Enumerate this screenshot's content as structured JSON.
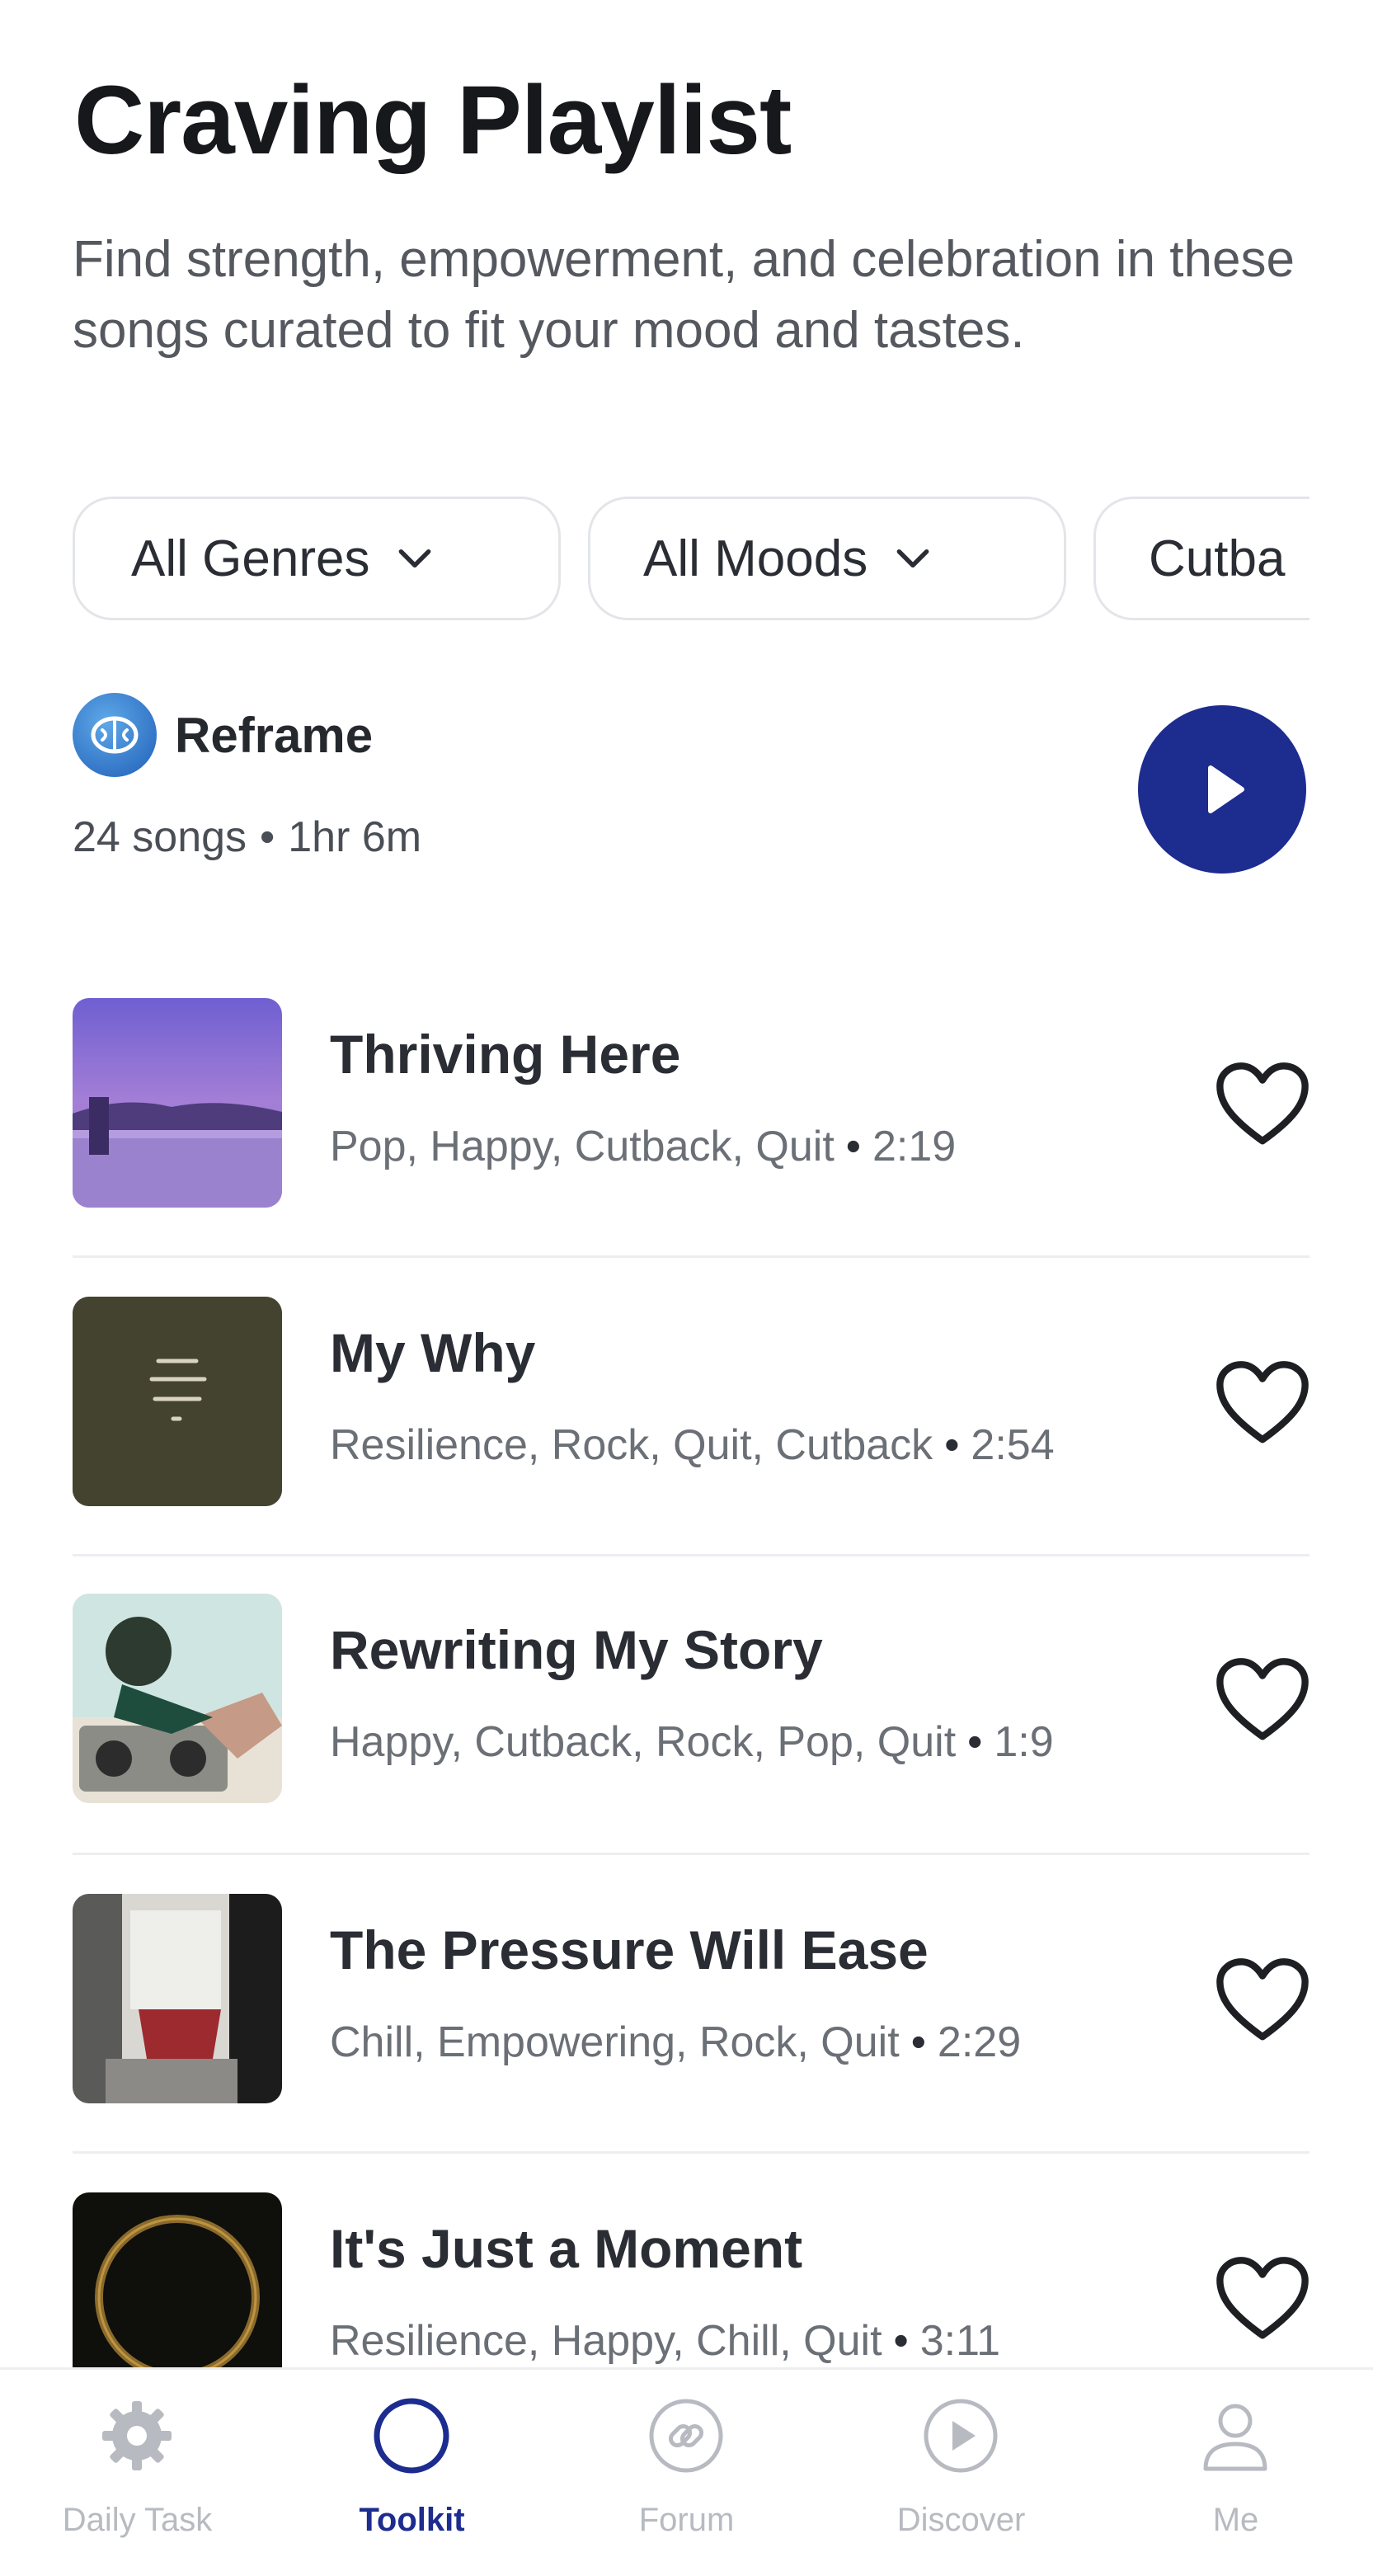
{
  "header": {
    "title": "Craving Playlist",
    "description": "Find strength, empowerment, and celebration in these songs curated to fit your mood and tastes."
  },
  "filters": {
    "genres_label": "All Genres",
    "moods_label": "All Moods",
    "third_label": "Cutba"
  },
  "playlist": {
    "brand_name": "Reframe",
    "song_count": "24 songs",
    "separator": "•",
    "duration": "1hr 6m"
  },
  "songs": [
    {
      "title": "Thriving Here",
      "tags": "Pop, Happy, Cutback, Quit",
      "duration": "2:19",
      "liked": false
    },
    {
      "title": "My Why",
      "tags": "Resilience, Rock, Quit, Cutback",
      "duration": "2:54",
      "liked": false
    },
    {
      "title": "Rewriting My Story",
      "tags": "Happy, Cutback, Rock, Pop, Quit",
      "duration": "1:9",
      "liked": false
    },
    {
      "title": "The Pressure Will Ease",
      "tags": "Chill, Empowering, Rock, Quit",
      "duration": "2:29",
      "liked": false
    },
    {
      "title": "It's Just a Moment",
      "tags": "Resilience, Happy, Chill, Quit",
      "duration": "3:11",
      "liked": false
    }
  ],
  "nav": {
    "items": [
      {
        "label": "Daily Task",
        "icon": "gear-icon"
      },
      {
        "label": "Toolkit",
        "icon": "circle-icon",
        "active": true
      },
      {
        "label": "Forum",
        "icon": "link-icon"
      },
      {
        "label": "Discover",
        "icon": "play-circle-icon"
      },
      {
        "label": "Me",
        "icon": "person-icon"
      }
    ]
  },
  "colors": {
    "accent": "#1d2c8f",
    "brand_logo": "#2f78d0",
    "text_primary": "#16181c",
    "text_secondary": "#6b6f76",
    "nav_inactive": "#b7bac0"
  }
}
